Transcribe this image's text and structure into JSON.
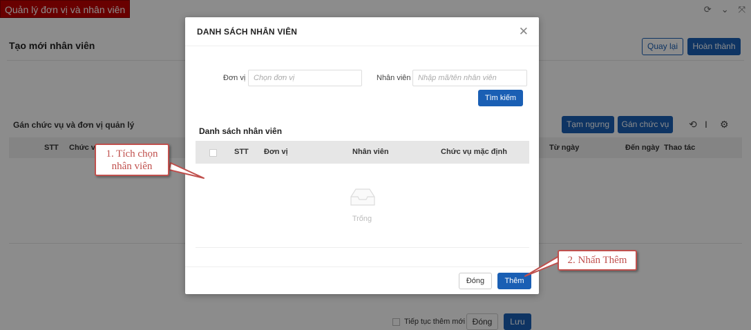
{
  "app": {
    "title": "Quản lý đơn vị và nhân viên"
  },
  "page": {
    "title": "Tạo mới nhân viên",
    "back_label": "Quay lại",
    "done_label": "Hoàn thành",
    "section_title": "Gán chức vụ và đơn vị quản lý",
    "suspend_label": "Tạm ngưng",
    "assign_label": "Gán chức vụ",
    "table_headers": [
      "STT",
      "Chức vụ",
      "Từ ngày",
      "Đến ngày",
      "Thao tác"
    ],
    "continue_label": "Tiếp tục thêm mới",
    "close_label": "Đóng",
    "save_label": "Lưu"
  },
  "modal": {
    "title": "DANH SÁCH NHÂN VIÊN",
    "unit_label": "Đơn vị",
    "unit_placeholder": "Chọn đơn vị",
    "employee_label": "Nhân viên",
    "employee_placeholder": "Nhập mã/tên nhân viên",
    "search_label": "Tìm kiếm",
    "list_title": "Danh sách nhân viên",
    "table_headers": [
      "STT",
      "Đơn vị",
      "Nhân viên",
      "Chức vụ mặc định"
    ],
    "empty_text": "Trống",
    "close_label": "Đóng",
    "add_label": "Thêm"
  },
  "annotations": {
    "step1_line1": "1. Tích chọn",
    "step1_line2": "nhân viên",
    "step2": "2. Nhấn Thêm",
    "color": "#c0504d"
  },
  "colors": {
    "primary": "#1a5fb4",
    "app_tag": "#c00000"
  }
}
